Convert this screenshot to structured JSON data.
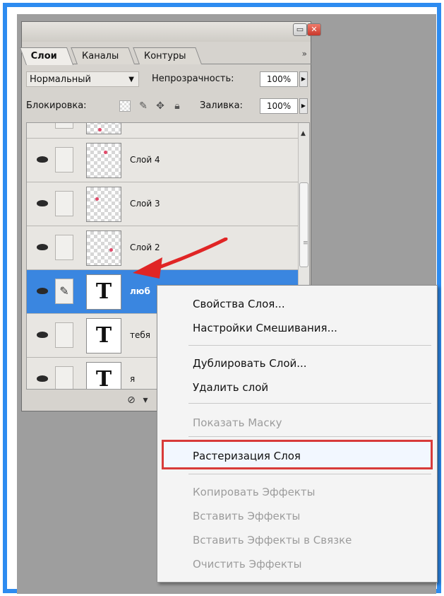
{
  "panel": {
    "tabs": [
      {
        "label": "Слои",
        "active": true
      },
      {
        "label": "Каналы",
        "active": false
      },
      {
        "label": "Контуры",
        "active": false
      }
    ],
    "menu_glyph": "»",
    "blend_mode": "Нормальный",
    "opacity_label": "Непрозрачность:",
    "opacity_value": "100%",
    "lock_label": "Блокировка:",
    "fill_label": "Заливка:",
    "fill_value": "100%",
    "layers": [
      {
        "name": "",
        "kind": "image"
      },
      {
        "name": "Слой 4",
        "kind": "image"
      },
      {
        "name": "Слой 3",
        "kind": "image"
      },
      {
        "name": "Слой 2",
        "kind": "image"
      },
      {
        "name": "люб",
        "kind": "text",
        "selected": true
      },
      {
        "name": "тебя",
        "kind": "text"
      },
      {
        "name": "я",
        "kind": "text"
      }
    ],
    "thumb_text": "T"
  },
  "context_menu": {
    "items": [
      {
        "label": "Свойства Слоя...",
        "enabled": true
      },
      {
        "label": "Настройки Смешивания...",
        "enabled": true
      },
      {
        "label": "Дублировать Слой...",
        "enabled": true
      },
      {
        "label": "Удалить слой",
        "enabled": true
      },
      {
        "label": "Показать Маску",
        "enabled": false
      },
      {
        "label": "Растеризация Слоя",
        "enabled": true,
        "highlighted": true
      },
      {
        "label": "Копировать Эффекты",
        "enabled": false
      },
      {
        "label": "Вставить Эффекты",
        "enabled": false
      },
      {
        "label": "Вставить Эффекты в Связке",
        "enabled": false
      },
      {
        "label": "Очистить Эффекты",
        "enabled": false
      }
    ]
  },
  "colors": {
    "frame": "#2d8bf0",
    "selection": "#3a86e0",
    "highlight_border": "#d83b3b",
    "arrow": "#e02525"
  }
}
